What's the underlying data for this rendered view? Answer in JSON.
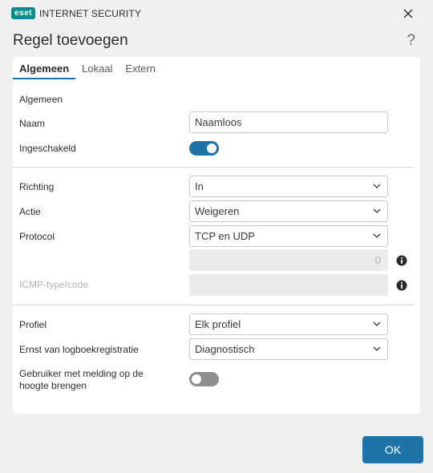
{
  "app": {
    "logo_mark": "eset",
    "product_name": "INTERNET SECURITY"
  },
  "dialog": {
    "title": "Regel toevoegen",
    "help_label": "?"
  },
  "tabs": [
    {
      "label": "Algemeen",
      "active": true
    },
    {
      "label": "Lokaal",
      "active": false
    },
    {
      "label": "Extern",
      "active": false
    }
  ],
  "general": {
    "section_label": "Algemeen",
    "name_label": "Naam",
    "name_value": "Naamloos",
    "enabled_label": "Ingeschakeld",
    "enabled": true
  },
  "rule": {
    "direction_label": "Richting",
    "direction_value": "In",
    "action_label": "Actie",
    "action_value": "Weigeren",
    "protocol_label": "Protocol",
    "protocol_value": "TCP en UDP",
    "protocol_number": "0",
    "icmp_label": "ICMP-type/code",
    "icmp_value": ""
  },
  "profile": {
    "profile_label": "Profiel",
    "profile_value": "Elk profiel",
    "log_label": "Ernst van logboekregistratie",
    "log_value": "Diagnostisch",
    "notify_label": "Gebruiker met melding op de hoogte brengen",
    "notify_enabled": false
  },
  "footer": {
    "ok_label": "OK"
  },
  "colors": {
    "accent": "#1e73a8",
    "brand": "#0b8c8c"
  }
}
